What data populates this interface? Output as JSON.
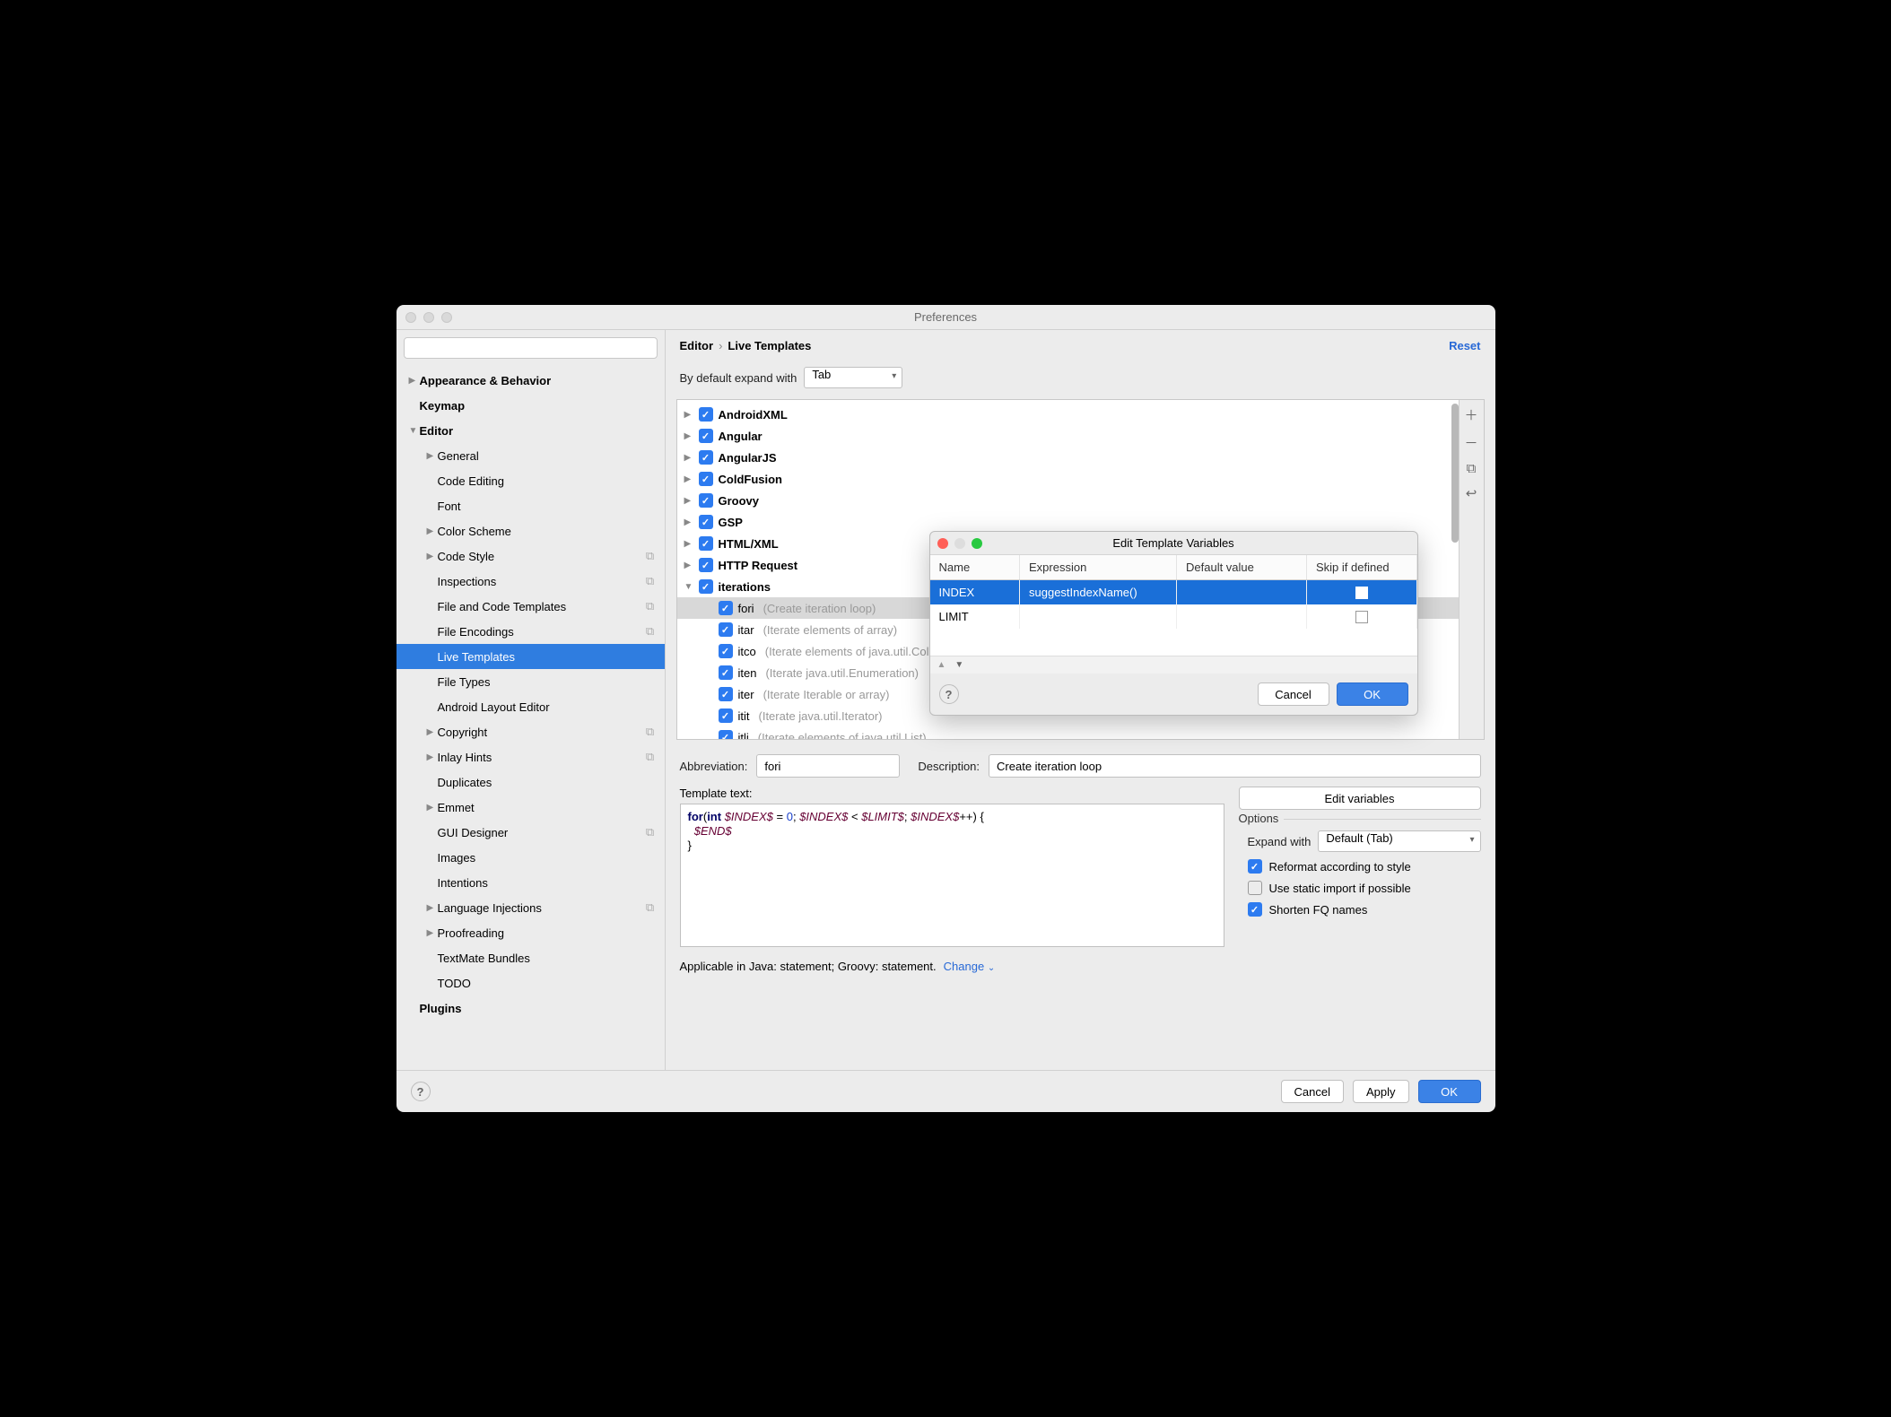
{
  "window": {
    "title": "Preferences"
  },
  "sidebar": {
    "search_placeholder": "",
    "items": [
      {
        "label": "Appearance & Behavior",
        "bold": true,
        "arrow": "▶"
      },
      {
        "label": "Keymap",
        "bold": true
      },
      {
        "label": "Editor",
        "bold": true,
        "arrow": "▼"
      },
      {
        "label": "General",
        "indent": 1,
        "arrow": "▶"
      },
      {
        "label": "Code Editing",
        "indent": 1
      },
      {
        "label": "Font",
        "indent": 1
      },
      {
        "label": "Color Scheme",
        "indent": 1,
        "arrow": "▶"
      },
      {
        "label": "Code Style",
        "indent": 1,
        "arrow": "▶",
        "icon": "⧉"
      },
      {
        "label": "Inspections",
        "indent": 1,
        "icon": "⧉"
      },
      {
        "label": "File and Code Templates",
        "indent": 1,
        "icon": "⧉"
      },
      {
        "label": "File Encodings",
        "indent": 1,
        "icon": "⧉"
      },
      {
        "label": "Live Templates",
        "indent": 1,
        "selected": true
      },
      {
        "label": "File Types",
        "indent": 1
      },
      {
        "label": "Android Layout Editor",
        "indent": 1
      },
      {
        "label": "Copyright",
        "indent": 1,
        "arrow": "▶",
        "icon": "⧉"
      },
      {
        "label": "Inlay Hints",
        "indent": 1,
        "arrow": "▶",
        "icon": "⧉"
      },
      {
        "label": "Duplicates",
        "indent": 1
      },
      {
        "label": "Emmet",
        "indent": 1,
        "arrow": "▶"
      },
      {
        "label": "GUI Designer",
        "indent": 1,
        "icon": "⧉"
      },
      {
        "label": "Images",
        "indent": 1
      },
      {
        "label": "Intentions",
        "indent": 1
      },
      {
        "label": "Language Injections",
        "indent": 1,
        "arrow": "▶",
        "icon": "⧉"
      },
      {
        "label": "Proofreading",
        "indent": 1,
        "arrow": "▶"
      },
      {
        "label": "TextMate Bundles",
        "indent": 1
      },
      {
        "label": "TODO",
        "indent": 1
      },
      {
        "label": "Plugins",
        "bold": true
      }
    ]
  },
  "breadcrumb": {
    "root": "Editor",
    "leaf": "Live Templates",
    "reset": "Reset"
  },
  "expand": {
    "label": "By default expand with",
    "value": "Tab"
  },
  "templates": [
    {
      "label": "AndroidXML",
      "arrow": "▶"
    },
    {
      "label": "Angular",
      "arrow": "▶"
    },
    {
      "label": "AngularJS",
      "arrow": "▶"
    },
    {
      "label": "ColdFusion",
      "arrow": "▶"
    },
    {
      "label": "Groovy",
      "arrow": "▶"
    },
    {
      "label": "GSP",
      "arrow": "▶"
    },
    {
      "label": "HTML/XML",
      "arrow": "▶"
    },
    {
      "label": "HTTP Request",
      "arrow": "▶"
    },
    {
      "label": "iterations",
      "arrow": "▼",
      "open": true
    }
  ],
  "templateChildren": [
    {
      "name": "fori",
      "desc": "(Create iteration loop)",
      "selected": true
    },
    {
      "name": "itar",
      "desc": "(Iterate elements of array)"
    },
    {
      "name": "itco",
      "desc": "(Iterate elements of java.util.Collection)"
    },
    {
      "name": "iten",
      "desc": "(Iterate java.util.Enumeration)"
    },
    {
      "name": "iter",
      "desc": "(Iterate Iterable or array)"
    },
    {
      "name": "itit",
      "desc": "(Iterate java.util.Iterator)"
    },
    {
      "name": "itli",
      "desc": "(Iterate elements of java.util.List)"
    }
  ],
  "fields": {
    "abbr_label": "Abbreviation:",
    "abbr_value": "fori",
    "desc_label": "Description:",
    "desc_value": "Create iteration loop",
    "ttext_label": "Template text:",
    "edit_vars": "Edit variables"
  },
  "template_code": {
    "l1a": "for",
    "l1b": "(",
    "l1c": "int ",
    "l1d": "$INDEX$",
    "l1e": " = ",
    "l1f": "0",
    "l1g": "; ",
    "l1h": "$INDEX$",
    "l1i": " < ",
    "l1j": "$LIMIT$",
    "l1k": "; ",
    "l1l": "$INDEX$",
    "l1m": "++) {",
    "l2a": "  ",
    "l2b": "$END$",
    "l3": "}"
  },
  "options": {
    "title": "Options",
    "expand_with": "Expand with",
    "expand_value": "Default (Tab)",
    "reformat": "Reformat according to style",
    "static_import": "Use static import if possible",
    "shorten": "Shorten FQ names"
  },
  "applicable": {
    "text": "Applicable in Java: statement; Groovy: statement.",
    "change": "Change"
  },
  "footer": {
    "cancel": "Cancel",
    "apply": "Apply",
    "ok": "OK"
  },
  "dialog": {
    "title": "Edit Template Variables",
    "headers": {
      "name": "Name",
      "expr": "Expression",
      "def": "Default value",
      "skip": "Skip if defined"
    },
    "rows": [
      {
        "name": "INDEX",
        "expr": "suggestIndexName()",
        "def": "",
        "skip": false,
        "selected": true
      },
      {
        "name": "LIMIT",
        "expr": "",
        "def": "",
        "skip": false
      }
    ],
    "cancel": "Cancel",
    "ok": "OK"
  }
}
